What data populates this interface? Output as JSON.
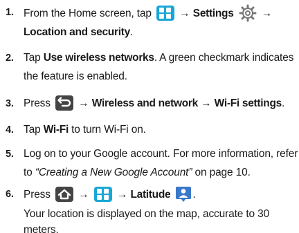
{
  "steps": [
    {
      "number": "1.",
      "line1": {
        "pre": "From the Home screen, tap",
        "arrow1": "→",
        "settings": "Settings",
        "arrow2": "→"
      },
      "line2": {
        "location": "Location and security",
        "dot": "."
      }
    },
    {
      "number": "2.",
      "line1": {
        "pre": "Tap",
        "bold": "Use wireless networks",
        "post": ". A green checkmark indicates"
      },
      "line2": {
        "text": "the feature is enabled."
      }
    },
    {
      "number": "3.",
      "line1": {
        "pre": "Press",
        "arrow1": "→",
        "bold": "Wireless and network",
        "arrow2": "→",
        "bold2": "Wi-Fi settings",
        "dot": "."
      }
    },
    {
      "number": "4.",
      "line1": {
        "pre": "Tap",
        "bold": "Wi-Fi",
        "post": "to turn Wi-Fi on."
      }
    },
    {
      "number": "5.",
      "line1": {
        "text": "Log on to your Google account. For more information, refer"
      },
      "line2": {
        "pre": "to",
        "italic": "“Creating a New Google Account”",
        "post": "on page 10."
      }
    },
    {
      "number": "6.",
      "line1": {
        "pre": "Press",
        "arrow1": "→",
        "arrow2": "→",
        "bold": "Latitude",
        "dot": "."
      },
      "line2": {
        "text": "Your location is displayed on the map, accurate to 30"
      },
      "line3": {
        "text": "meters."
      }
    }
  ],
  "icons": {
    "apps": "apps-grid-icon",
    "settings": "settings-gear-icon",
    "back": "back-arrow-icon",
    "home": "home-icon",
    "latitude": "latitude-person-icon"
  },
  "colors": {
    "apps": "#1aa7d6",
    "dark_key": "#444444",
    "settings": "#888888",
    "latitude": "#3a78c9"
  }
}
